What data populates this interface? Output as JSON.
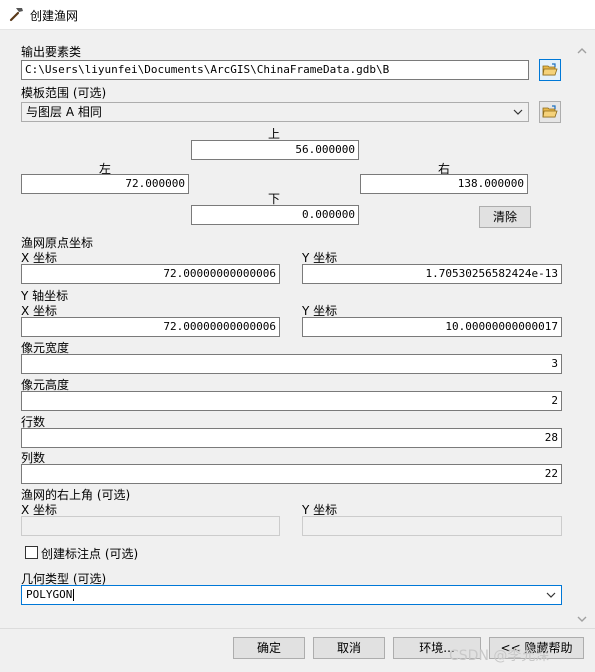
{
  "window": {
    "title": "创建渔网"
  },
  "output_features": {
    "label": "输出要素类",
    "value": "C:\\Users\\liyunfei\\Documents\\ArcGIS\\ChinaFrameData.gdb\\B"
  },
  "template_extent": {
    "label": "模板范围 (可选)",
    "selected": "与图层 A 相同",
    "top_label": "上",
    "top_value": "56.000000",
    "left_label": "左",
    "left_value": "72.000000",
    "right_label": "右",
    "right_value": "138.000000",
    "bottom_label": "下",
    "bottom_value": "0.000000",
    "clear_label": "清除"
  },
  "origin": {
    "label": "渔网原点坐标",
    "x_label": "X 坐标",
    "x_value": "72.00000000000006",
    "y_label": "Y 坐标",
    "y_value": "1.70530256582424e-13"
  },
  "y_axis": {
    "label": "Y 轴坐标",
    "x_label": "X 坐标",
    "x_value": "72.00000000000006",
    "y_label": "Y 坐标",
    "y_value": "10.00000000000017"
  },
  "cell_width": {
    "label": "像元宽度",
    "value": "3"
  },
  "cell_height": {
    "label": "像元高度",
    "value": "2"
  },
  "rows": {
    "label": "行数",
    "value": "28"
  },
  "cols": {
    "label": "列数",
    "value": "22"
  },
  "corner": {
    "label": "渔网的右上角 (可选)",
    "x_label": "X 坐标",
    "x_value": "",
    "y_label": "Y 坐标",
    "y_value": ""
  },
  "labels_checkbox": {
    "label": "创建标注点 (可选)",
    "checked": false
  },
  "geometry": {
    "label": "几何类型 (可选)",
    "selected": "POLYGON"
  },
  "buttons": {
    "ok": "确定",
    "cancel": "取消",
    "env": "环境...",
    "help": "<< 隐藏帮助"
  },
  "watermark": "CSDN @李允深",
  "colors": {
    "focus": "#0078d7",
    "folder": "#e8b84a"
  },
  "icons": {
    "title": "hammer-icon",
    "folder": "folder-open-icon",
    "dropdown": "chevron-down-icon"
  }
}
